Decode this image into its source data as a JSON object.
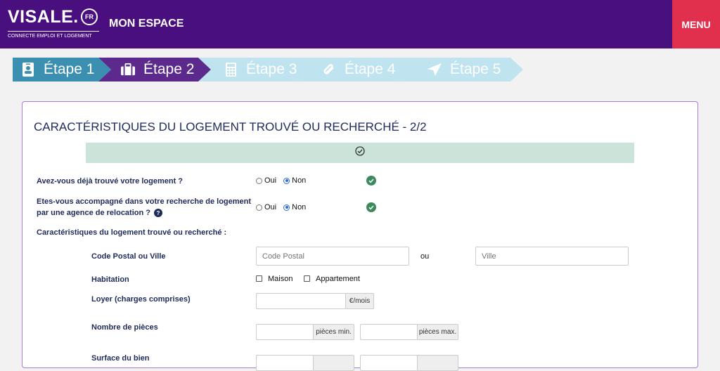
{
  "header": {
    "logo_text": "VISALE.",
    "logo_badge": "FR",
    "logo_tagline": "CONNECTE EMPLOI ET LOGEMENT",
    "title": "MON ESPACE",
    "menu_label": "MENU",
    "colors": {
      "header_bg": "#4a0f7f",
      "menu_bg": "#e0304e"
    }
  },
  "steps": [
    {
      "label": "Étape 1",
      "icon": "id-badge-icon",
      "state": "completed",
      "color": "#3b8fb0"
    },
    {
      "label": "Étape 2",
      "icon": "suitcase-icon",
      "state": "active",
      "color": "#5b2a8c"
    },
    {
      "label": "Étape 3",
      "icon": "calculator-icon",
      "state": "upcoming",
      "color": "#bfe3ef"
    },
    {
      "label": "Étape 4",
      "icon": "paperclip-icon",
      "state": "upcoming",
      "color": "#bfe3ef"
    },
    {
      "label": "Étape 5",
      "icon": "paper-plane-icon",
      "state": "upcoming",
      "color": "#bfe3ef"
    }
  ],
  "form": {
    "title": "CARACTÉRISTIQUES DU LOGEMENT TROUVÉ OU RECHERCHÉ - 2/2",
    "status_icon": "check-circle-icon",
    "q1": {
      "label": "Avez-vous déjà trouvé votre logement ?",
      "oui": "Oui",
      "non": "Non",
      "selected": "Non"
    },
    "q2": {
      "label_line1": "Etes-vous accompagné dans votre recherche de logement",
      "label_line2": "par une agence de relocation ?",
      "oui": "Oui",
      "non": "Non",
      "selected": "Non"
    },
    "section_label": "Caractéristiques du logement trouvé ou recherché :",
    "postal": {
      "label": "Code Postal ou Ville",
      "cp_placeholder": "Code Postal",
      "or": "ou",
      "city_placeholder": "Ville"
    },
    "habitation": {
      "label": "Habitation",
      "maison": "Maison",
      "appartement": "Appartement"
    },
    "loyer": {
      "label": "Loyer (charges comprises)",
      "unit": "€/mois"
    },
    "pieces": {
      "label": "Nombre de pièces",
      "min_unit": "pièces min.",
      "max_unit": "pièces max."
    },
    "surface": {
      "label": "Surface du bien"
    }
  }
}
